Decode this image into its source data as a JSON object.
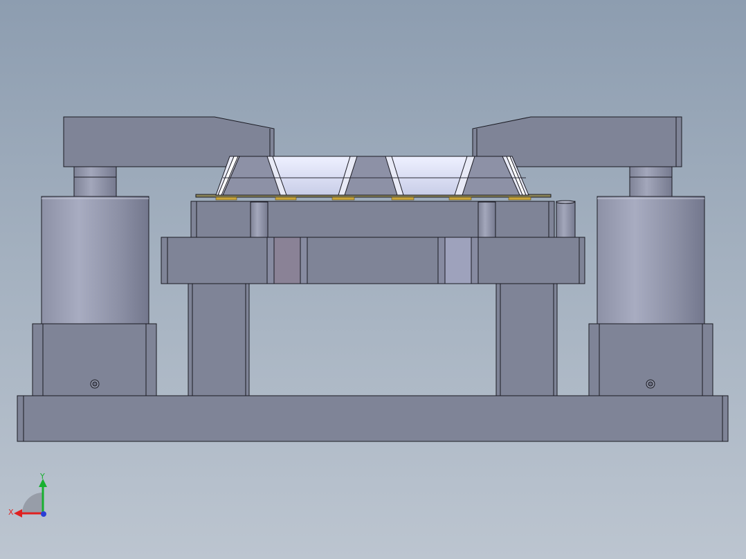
{
  "viewport": {
    "background_top": "#8d9db0",
    "background_bottom": "#bcc5d0"
  },
  "model": {
    "body_fill": "#7f8497",
    "body_fill_light": "#8a8fa2",
    "edge_color": "#1a1a22",
    "cylinder_light": "#a4a8bd",
    "cylinder_dark": "#757990",
    "glass_fill": "#dfe3f7",
    "pcb_color": "#8a8458",
    "pad_color": "#c9a53a"
  },
  "triad": {
    "x_label": "X",
    "y_label": "Y",
    "x_color": "#e02020",
    "y_color": "#18b030",
    "z_color": "#2b3fd6"
  }
}
